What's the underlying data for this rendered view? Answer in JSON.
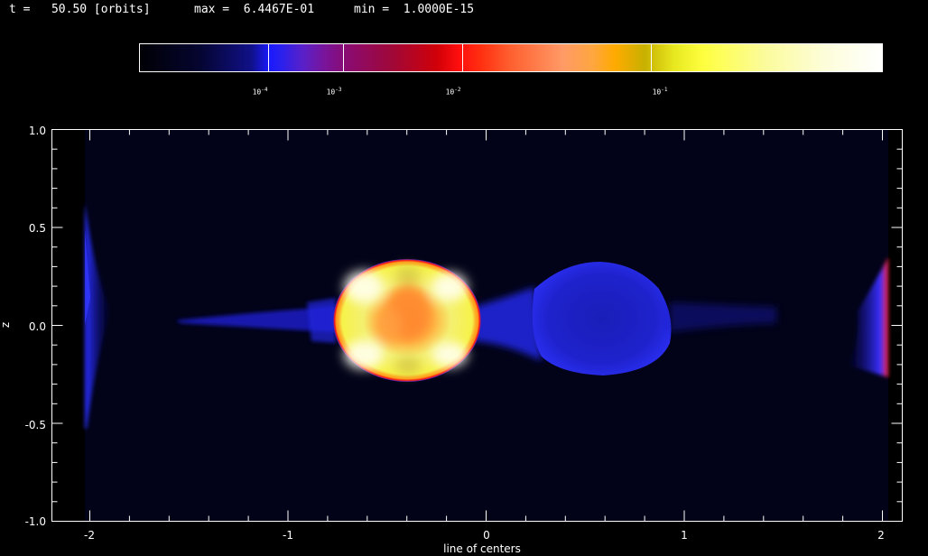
{
  "header": {
    "time_text": "t =   50.50 [orbits]",
    "max_text": "max =  6.4467E-01",
    "min_text": "min =  1.0000E-15"
  },
  "colorbar": {
    "tick_labels": [
      {
        "base": "10",
        "exp": "-4"
      },
      {
        "base": "10",
        "exp": "-3"
      },
      {
        "base": "10",
        "exp": "-2"
      },
      {
        "base": "10",
        "exp": "-1"
      }
    ]
  },
  "axes": {
    "xlabel": "line of centers",
    "ylabel": "z",
    "x_tick_labels": [
      "-2",
      "-1",
      "0",
      "1",
      "2"
    ],
    "y_tick_labels": [
      "1.0",
      "0.5",
      "0.0",
      "-0.5",
      "-1.0"
    ]
  },
  "colors": {
    "background": "#000000",
    "plot_bg": "#020318",
    "blue_gas": "#1c20d0",
    "bright_blue": "#2a30ff",
    "hot_core": "#ffff66",
    "rim_red": "#ff1010"
  }
}
